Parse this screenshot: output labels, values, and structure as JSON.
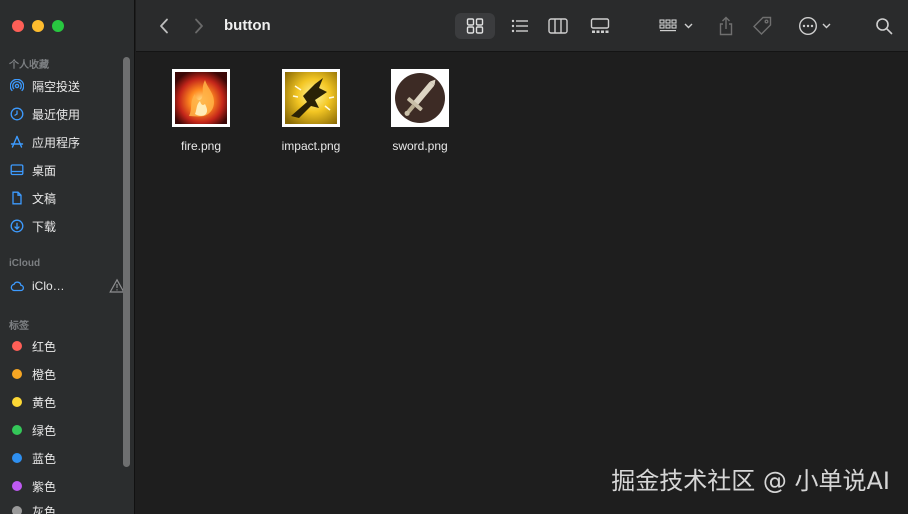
{
  "window": {
    "folder_title": "button"
  },
  "sidebar": {
    "favorites_title": "个人收藏",
    "favorites": [
      {
        "label": "隔空投送",
        "icon": "airdrop-icon"
      },
      {
        "label": "最近使用",
        "icon": "clock-icon"
      },
      {
        "label": "应用程序",
        "icon": "apps-icon"
      },
      {
        "label": "桌面",
        "icon": "desktop-icon"
      },
      {
        "label": "文稿",
        "icon": "document-icon"
      },
      {
        "label": "下载",
        "icon": "download-icon"
      }
    ],
    "icloud_title": "iCloud",
    "icloud_item": {
      "label": "iClo…",
      "icon": "cloud-icon"
    },
    "tags_title": "标签",
    "tags": [
      {
        "label": "红色",
        "color": "#ff5f57"
      },
      {
        "label": "橙色",
        "color": "#f6a623"
      },
      {
        "label": "黄色",
        "color": "#fdd835"
      },
      {
        "label": "绿色",
        "color": "#34c759"
      },
      {
        "label": "蓝色",
        "color": "#2e8ff0"
      },
      {
        "label": "紫色",
        "color": "#bf5af2"
      },
      {
        "label": "灰色",
        "color": "#9a9a9a"
      }
    ]
  },
  "files": [
    {
      "name": "fire.png",
      "icon": "fire-thumbnail"
    },
    {
      "name": "impact.png",
      "icon": "impact-thumbnail"
    },
    {
      "name": "sword.png",
      "icon": "sword-thumbnail"
    }
  ],
  "watermark": "掘金技术社区 @ 小单说AI"
}
